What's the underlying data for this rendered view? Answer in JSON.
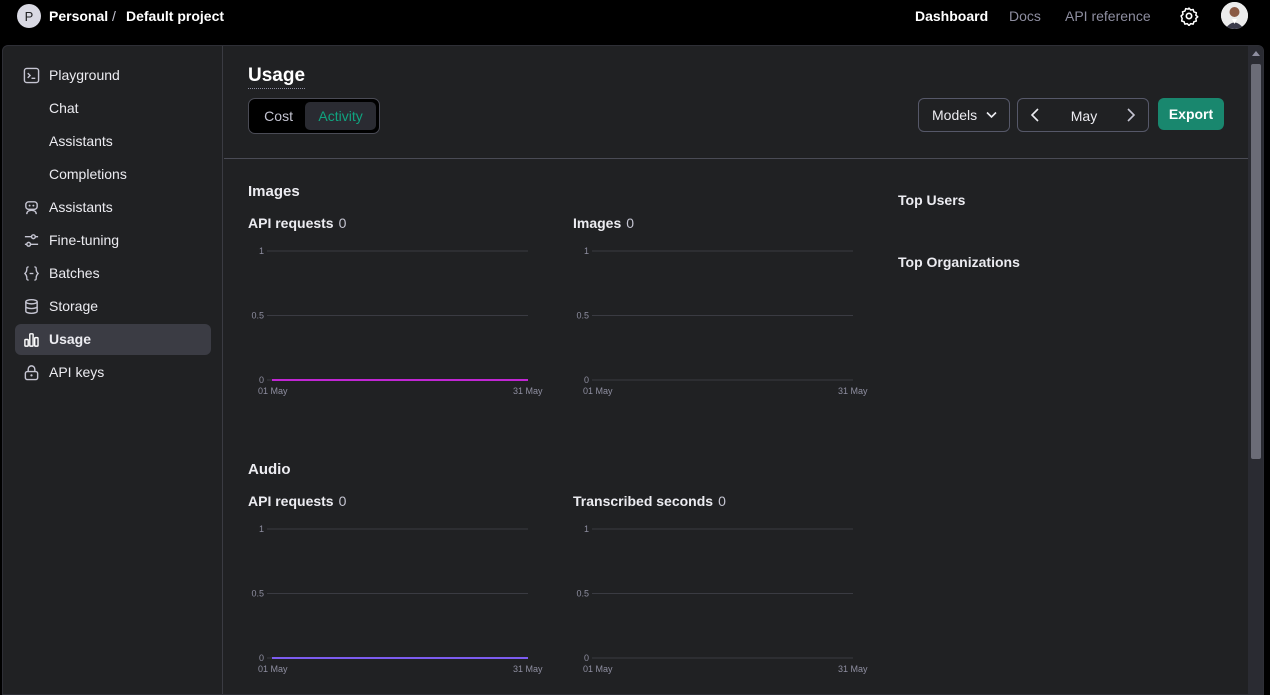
{
  "topbar": {
    "org_initial": "P",
    "org_name": "Personal",
    "separator": "/",
    "project_name": "Default project",
    "nav": [
      "Dashboard",
      "Docs",
      "API reference"
    ]
  },
  "sidebar": {
    "items": [
      {
        "label": "Playground",
        "icon": "terminal-icon"
      },
      {
        "label": "Chat",
        "icon": ""
      },
      {
        "label": "Assistants",
        "icon": ""
      },
      {
        "label": "Completions",
        "icon": ""
      },
      {
        "label": "Assistants",
        "icon": "robot-icon"
      },
      {
        "label": "Fine-tuning",
        "icon": "sliders-icon"
      },
      {
        "label": "Batches",
        "icon": "braces-icon"
      },
      {
        "label": "Storage",
        "icon": "database-icon"
      },
      {
        "label": "Usage",
        "icon": "bar-chart-icon",
        "active": true
      },
      {
        "label": "API keys",
        "icon": "lock-icon"
      }
    ]
  },
  "main": {
    "title": "Usage",
    "tabs": [
      "Cost",
      "Activity"
    ],
    "active_tab": "Activity",
    "models_label": "Models",
    "month": "May",
    "export_label": "Export",
    "top_users": "Top Users",
    "top_orgs": "Top Organizations"
  },
  "sections": [
    {
      "title": "Images",
      "charts": [
        {
          "label": "API requests",
          "value": "0"
        },
        {
          "label": "Images",
          "value": "0"
        }
      ]
    },
    {
      "title": "Audio",
      "charts": [
        {
          "label": "API requests",
          "value": "0"
        },
        {
          "label": "Transcribed seconds",
          "value": "0"
        }
      ]
    }
  ],
  "chart_data": [
    {
      "type": "line",
      "title": "API requests",
      "x": [
        "01 May",
        "31 May"
      ],
      "y_ticks": [
        "0",
        "0.5",
        "1"
      ],
      "ylim": [
        0,
        1
      ],
      "series": [
        {
          "values": [
            0,
            0
          ],
          "color": "#c026d3"
        }
      ]
    },
    {
      "type": "line",
      "title": "Images",
      "x": [
        "01 May",
        "31 May"
      ],
      "y_ticks": [
        "0",
        "0.5",
        "1"
      ],
      "ylim": [
        0,
        1
      ],
      "series": []
    },
    {
      "type": "line",
      "title": "API requests",
      "x": [
        "01 May",
        "31 May"
      ],
      "y_ticks": [
        "0",
        "0.5",
        "1"
      ],
      "ylim": [
        0,
        1
      ],
      "series": [
        {
          "values": [
            0,
            0
          ],
          "color": "#7c5cf0"
        }
      ]
    },
    {
      "type": "line",
      "title": "Transcribed seconds",
      "x": [
        "01 May",
        "31 May"
      ],
      "y_ticks": [
        "0",
        "0.5",
        "1"
      ],
      "ylim": [
        0,
        1
      ],
      "series": []
    }
  ],
  "colors": {
    "accent": "#10a37f",
    "export_bg": "#19876e"
  }
}
